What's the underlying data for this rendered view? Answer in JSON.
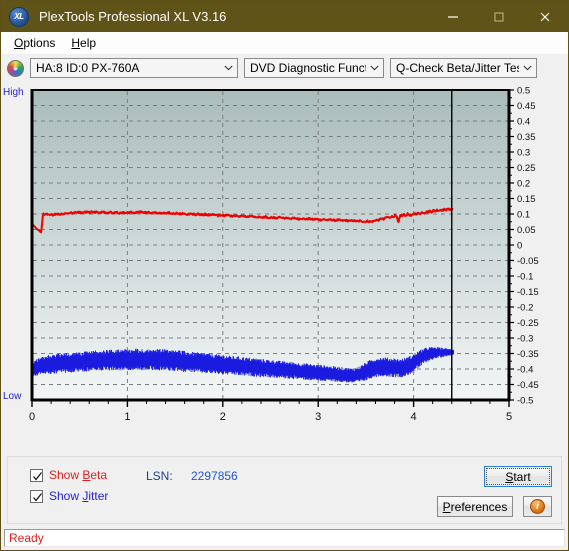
{
  "window": {
    "title": "PlexTools Professional XL V3.16",
    "icon": "app-xl-icon",
    "icon_text": "XL",
    "minimize": "minimize-icon",
    "maximize": "maximize-icon",
    "close": "close-icon",
    "titlebar_color": "#5f5318"
  },
  "menu": {
    "items": [
      {
        "label": "Options",
        "accel": "O"
      },
      {
        "label": "Help",
        "accel": "H"
      }
    ]
  },
  "toolbar": {
    "drive_icon": "disc-icon",
    "drive_select": "HA:8 ID:0  PX-760A",
    "function_select": "DVD Diagnostic Functions",
    "test_select": "Q-Check Beta/Jitter Test",
    "dropdown_icon": "chevron-down-icon"
  },
  "controls": {
    "show_beta": {
      "label": "Show Beta",
      "accel": "B",
      "checked": true,
      "color": "#e02020"
    },
    "show_jitter": {
      "label": "Show Jitter",
      "accel": "J",
      "checked": true,
      "color": "#2222dd"
    },
    "lsn_label": "LSN:",
    "lsn_value": "2297856",
    "start_button": "Start",
    "start_accel": "S",
    "preferences_button": "Preferences",
    "preferences_accel": "P",
    "info_button": "info-icon",
    "info_glyph": "i"
  },
  "status": {
    "text": "Ready",
    "color": "#e02020"
  },
  "chart_data": {
    "type": "line",
    "title": "",
    "xlabel": "",
    "ylabel": "",
    "xlim": [
      0,
      5
    ],
    "ylim": [
      -0.5,
      0.5
    ],
    "xticks": [
      0,
      1,
      2,
      3,
      4,
      5
    ],
    "xticklabels": [
      "0",
      "1",
      "2",
      "3",
      "4",
      "5"
    ],
    "yticks": [
      0.5,
      0.45,
      0.4,
      0.35,
      0.3,
      0.25,
      0.2,
      0.15,
      0.1,
      0.05,
      0,
      -0.05,
      -0.1,
      -0.15,
      -0.2,
      -0.25,
      -0.3,
      -0.35,
      -0.4,
      -0.45,
      -0.5
    ],
    "yticklabels": [
      "0.5",
      "0.45",
      "0.4",
      "0.35",
      "0.3",
      "0.25",
      "0.2",
      "0.15",
      "0.1",
      "0.05",
      "0",
      "-0.05",
      "-0.1",
      "-0.15",
      "-0.2",
      "-0.25",
      "-0.3",
      "-0.35",
      "-0.4",
      "-0.45",
      "-0.5"
    ],
    "axis_left_label": "High",
    "axis_left_label_bottom": "Low",
    "grid": true,
    "cursor_x": 4.4,
    "plot_bg_top": "#a9bcbb",
    "plot_bg_bottom": "#f3f6f6",
    "series": [
      {
        "name": "Beta",
        "color": "#ee0000",
        "x_start": 0.0,
        "x_end": 4.42,
        "n": 230,
        "values": [
          0.07,
          0.062,
          0.056,
          0.05,
          0.046,
          0.043,
          0.1,
          0.097,
          0.099,
          0.098,
          0.098,
          0.097,
          0.099,
          0.098,
          0.1,
          0.099,
          0.101,
          0.1,
          0.102,
          0.101,
          0.103,
          0.104,
          0.103,
          0.105,
          0.104,
          0.106,
          0.105,
          0.104,
          0.106,
          0.105,
          0.106,
          0.105,
          0.107,
          0.106,
          0.105,
          0.107,
          0.106,
          0.105,
          0.107,
          0.106,
          0.105,
          0.104,
          0.106,
          0.105,
          0.104,
          0.106,
          0.105,
          0.104,
          0.103,
          0.105,
          0.104,
          0.103,
          0.105,
          0.104,
          0.106,
          0.105,
          0.104,
          0.106,
          0.105,
          0.107,
          0.106,
          0.105,
          0.104,
          0.106,
          0.105,
          0.104,
          0.103,
          0.105,
          0.104,
          0.103,
          0.102,
          0.104,
          0.103,
          0.102,
          0.104,
          0.103,
          0.102,
          0.101,
          0.103,
          0.102,
          0.101,
          0.1,
          0.102,
          0.101,
          0.1,
          0.099,
          0.101,
          0.1,
          0.099,
          0.098,
          0.1,
          0.099,
          0.098,
          0.097,
          0.099,
          0.098,
          0.097,
          0.096,
          0.098,
          0.097,
          0.096,
          0.095,
          0.097,
          0.096,
          0.095,
          0.094,
          0.096,
          0.095,
          0.094,
          0.093,
          0.095,
          0.094,
          0.093,
          0.092,
          0.094,
          0.093,
          0.092,
          0.091,
          0.093,
          0.092,
          0.091,
          0.09,
          0.092,
          0.091,
          0.09,
          0.089,
          0.091,
          0.09,
          0.089,
          0.088,
          0.09,
          0.089,
          0.088,
          0.087,
          0.089,
          0.088,
          0.087,
          0.086,
          0.088,
          0.087,
          0.086,
          0.085,
          0.087,
          0.086,
          0.085,
          0.084,
          0.086,
          0.085,
          0.084,
          0.083,
          0.085,
          0.084,
          0.083,
          0.082,
          0.084,
          0.083,
          0.082,
          0.081,
          0.083,
          0.082,
          0.081,
          0.08,
          0.082,
          0.081,
          0.08,
          0.079,
          0.081,
          0.08,
          0.079,
          0.078,
          0.08,
          0.079,
          0.078,
          0.077,
          0.079,
          0.078,
          0.077,
          0.076,
          0.078,
          0.077,
          0.076,
          0.075,
          0.077,
          0.076,
          0.075,
          0.076,
          0.078,
          0.081,
          0.079,
          0.083,
          0.086,
          0.082,
          0.088,
          0.091,
          0.087,
          0.093,
          0.09,
          0.095,
          0.092,
          0.07,
          0.096,
          0.094,
          0.098,
          0.095,
          0.1,
          0.097,
          0.093,
          0.099,
          0.102,
          0.099,
          0.104,
          0.101,
          0.106,
          0.103,
          0.108,
          0.105,
          0.11,
          0.107,
          0.112,
          0.109,
          0.113,
          0.111,
          0.114,
          0.112,
          0.115,
          0.113,
          0.116,
          0.114,
          0.117,
          0.115
        ]
      },
      {
        "name": "Jitter",
        "color": "#1a1ae0",
        "x_start": 0.0,
        "x_end": 4.42,
        "n": 230,
        "band_center": [
          -0.4,
          -0.398,
          -0.396,
          -0.394,
          -0.392,
          -0.39,
          -0.389,
          -0.388,
          -0.387,
          -0.386,
          -0.385,
          -0.384,
          -0.384,
          -0.383,
          -0.383,
          -0.382,
          -0.382,
          -0.381,
          -0.381,
          -0.38,
          -0.38,
          -0.379,
          -0.379,
          -0.378,
          -0.378,
          -0.377,
          -0.377,
          -0.376,
          -0.376,
          -0.376,
          -0.375,
          -0.375,
          -0.375,
          -0.374,
          -0.374,
          -0.374,
          -0.373,
          -0.373,
          -0.373,
          -0.372,
          -0.372,
          -0.372,
          -0.372,
          -0.371,
          -0.371,
          -0.371,
          -0.371,
          -0.371,
          -0.37,
          -0.37,
          -0.37,
          -0.37,
          -0.37,
          -0.37,
          -0.37,
          -0.369,
          -0.369,
          -0.369,
          -0.369,
          -0.369,
          -0.369,
          -0.369,
          -0.369,
          -0.369,
          -0.369,
          -0.369,
          -0.37,
          -0.37,
          -0.37,
          -0.37,
          -0.37,
          -0.371,
          -0.371,
          -0.371,
          -0.372,
          -0.372,
          -0.372,
          -0.373,
          -0.373,
          -0.374,
          -0.374,
          -0.375,
          -0.375,
          -0.376,
          -0.376,
          -0.377,
          -0.377,
          -0.378,
          -0.378,
          -0.379,
          -0.379,
          -0.38,
          -0.38,
          -0.381,
          -0.381,
          -0.382,
          -0.382,
          -0.383,
          -0.383,
          -0.384,
          -0.384,
          -0.385,
          -0.385,
          -0.386,
          -0.386,
          -0.387,
          -0.387,
          -0.388,
          -0.388,
          -0.389,
          -0.389,
          -0.39,
          -0.39,
          -0.391,
          -0.391,
          -0.392,
          -0.392,
          -0.393,
          -0.393,
          -0.394,
          -0.394,
          -0.395,
          -0.395,
          -0.396,
          -0.396,
          -0.397,
          -0.397,
          -0.398,
          -0.398,
          -0.399,
          -0.399,
          -0.4,
          -0.4,
          -0.401,
          -0.401,
          -0.402,
          -0.402,
          -0.403,
          -0.403,
          -0.404,
          -0.404,
          -0.405,
          -0.405,
          -0.406,
          -0.406,
          -0.407,
          -0.407,
          -0.408,
          -0.408,
          -0.409,
          -0.409,
          -0.41,
          -0.41,
          -0.411,
          -0.411,
          -0.412,
          -0.412,
          -0.413,
          -0.413,
          -0.414,
          -0.414,
          -0.415,
          -0.415,
          -0.416,
          -0.416,
          -0.417,
          -0.417,
          -0.418,
          -0.418,
          -0.419,
          -0.419,
          -0.42,
          -0.42,
          -0.421,
          -0.421,
          -0.421,
          -0.42,
          -0.419,
          -0.417,
          -0.415,
          -0.412,
          -0.409,
          -0.406,
          -0.403,
          -0.4,
          -0.398,
          -0.396,
          -0.395,
          -0.394,
          -0.393,
          -0.393,
          -0.393,
          -0.393,
          -0.394,
          -0.394,
          -0.395,
          -0.395,
          -0.396,
          -0.396,
          -0.397,
          -0.397,
          -0.396,
          -0.395,
          -0.393,
          -0.391,
          -0.388,
          -0.385,
          -0.381,
          -0.377,
          -0.373,
          -0.369,
          -0.365,
          -0.361,
          -0.358,
          -0.355,
          -0.353,
          -0.351,
          -0.35,
          -0.349,
          -0.348,
          -0.348,
          -0.347,
          -0.347,
          -0.347,
          -0.346,
          -0.346,
          -0.346,
          -0.346,
          -0.345,
          -0.345
        ],
        "band_half_width": [
          0.024,
          0.026,
          0.027,
          0.028,
          0.029,
          0.029,
          0.03,
          0.03,
          0.03,
          0.031,
          0.031,
          0.031,
          0.031,
          0.031,
          0.032,
          0.032,
          0.032,
          0.032,
          0.032,
          0.032,
          0.032,
          0.032,
          0.033,
          0.033,
          0.033,
          0.033,
          0.033,
          0.033,
          0.033,
          0.033,
          0.033,
          0.033,
          0.034,
          0.034,
          0.034,
          0.034,
          0.034,
          0.034,
          0.034,
          0.034,
          0.034,
          0.034,
          0.034,
          0.034,
          0.034,
          0.034,
          0.035,
          0.035,
          0.035,
          0.035,
          0.035,
          0.035,
          0.035,
          0.035,
          0.035,
          0.035,
          0.035,
          0.035,
          0.035,
          0.035,
          0.035,
          0.035,
          0.035,
          0.035,
          0.035,
          0.035,
          0.035,
          0.035,
          0.035,
          0.035,
          0.035,
          0.035,
          0.035,
          0.035,
          0.034,
          0.034,
          0.034,
          0.034,
          0.034,
          0.034,
          0.034,
          0.034,
          0.034,
          0.034,
          0.034,
          0.034,
          0.033,
          0.033,
          0.033,
          0.033,
          0.033,
          0.033,
          0.033,
          0.033,
          0.033,
          0.033,
          0.033,
          0.032,
          0.032,
          0.032,
          0.032,
          0.032,
          0.032,
          0.032,
          0.032,
          0.032,
          0.032,
          0.031,
          0.031,
          0.031,
          0.031,
          0.031,
          0.031,
          0.031,
          0.031,
          0.031,
          0.03,
          0.03,
          0.03,
          0.03,
          0.03,
          0.03,
          0.03,
          0.03,
          0.03,
          0.029,
          0.029,
          0.029,
          0.029,
          0.029,
          0.029,
          0.029,
          0.029,
          0.029,
          0.028,
          0.028,
          0.028,
          0.028,
          0.028,
          0.028,
          0.028,
          0.028,
          0.028,
          0.027,
          0.027,
          0.027,
          0.027,
          0.027,
          0.027,
          0.027,
          0.027,
          0.027,
          0.026,
          0.026,
          0.026,
          0.026,
          0.026,
          0.026,
          0.026,
          0.026,
          0.026,
          0.025,
          0.025,
          0.025,
          0.025,
          0.025,
          0.025,
          0.025,
          0.025,
          0.024,
          0.024,
          0.024,
          0.024,
          0.024,
          0.024,
          0.024,
          0.025,
          0.026,
          0.027,
          0.028,
          0.029,
          0.03,
          0.03,
          0.031,
          0.031,
          0.031,
          0.031,
          0.031,
          0.031,
          0.031,
          0.031,
          0.031,
          0.031,
          0.031,
          0.031,
          0.031,
          0.031,
          0.031,
          0.03,
          0.03,
          0.03,
          0.03,
          0.03,
          0.03,
          0.03,
          0.03,
          0.029,
          0.029,
          0.029,
          0.028,
          0.028,
          0.027,
          0.026,
          0.025,
          0.024,
          0.023,
          0.022,
          0.021,
          0.02,
          0.019,
          0.018,
          0.017,
          0.016,
          0.015,
          0.014,
          0.013,
          0.012,
          0.011,
          0.01,
          0.009
        ]
      }
    ]
  }
}
